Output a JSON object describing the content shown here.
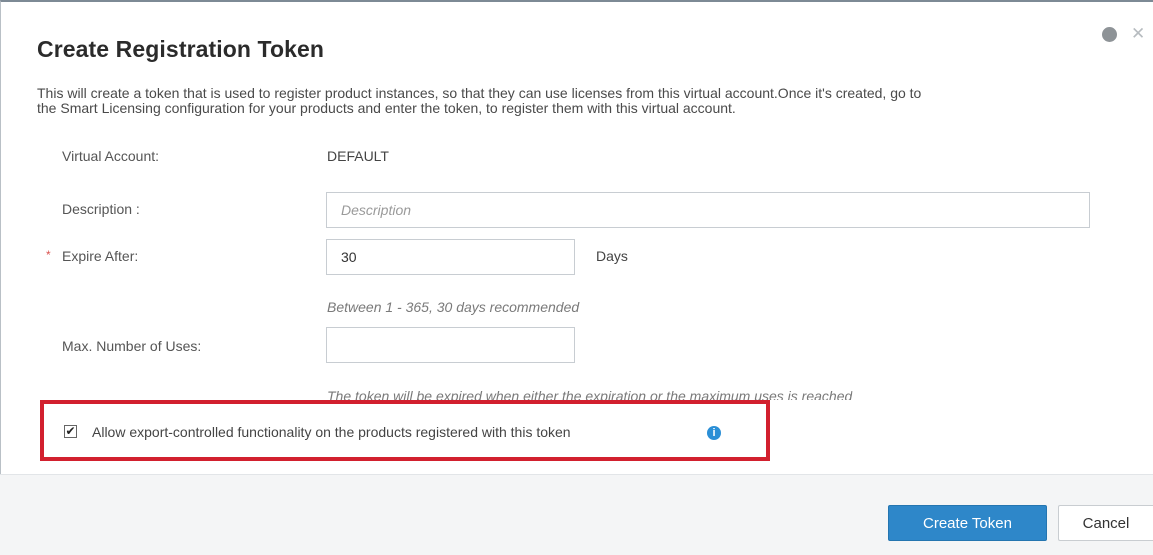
{
  "dialog": {
    "title": "Create Registration Token",
    "intro_line1": "This will create a token that is used to register product instances, so that they can use licenses from this virtual account.Once it's created, go to",
    "intro_line2": "the Smart Licensing configuration for your products and enter the token, to register them with this virtual account."
  },
  "form": {
    "virtual_account_label": "Virtual Account:",
    "virtual_account_value": "DEFAULT",
    "description_label": "Description :",
    "description_placeholder": "Description",
    "description_value": "",
    "expire_after_label": "Expire After:",
    "expire_after_value": "30",
    "expire_after_unit": "Days",
    "expire_after_hint": "Between 1 - 365, 30 days recommended",
    "max_uses_label": "Max. Number of Uses:",
    "max_uses_value": "",
    "max_uses_hint": "The token will be expired when either the expiration or the maximum uses is reached",
    "export_controlled_label": "Allow export-controlled functionality on the products registered with this token",
    "export_controlled_checked": true
  },
  "footer": {
    "create_label": "Create Token",
    "cancel_label": "Cancel"
  },
  "colors": {
    "primary_button": "#2e87c9",
    "highlight_border": "#d2202e",
    "info_icon": "#2b8fd6",
    "required_star": "#d9534f"
  },
  "icons": {
    "help": "help-icon",
    "close": "close-icon",
    "info": "info-icon",
    "check": "check-icon"
  }
}
